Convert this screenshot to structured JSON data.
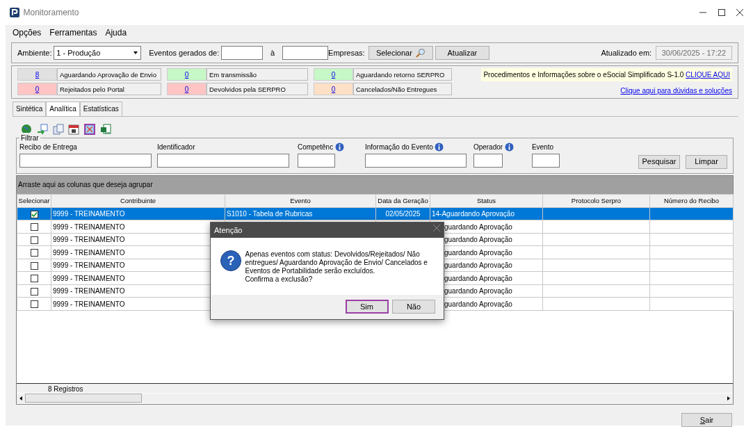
{
  "window": {
    "title": "Monitoramento"
  },
  "menu": [
    "Opções",
    "Ferramentas",
    "Ajuda"
  ],
  "top_bar": {
    "ambiente_label": "Ambiente:",
    "ambiente_value": "1 - Produção",
    "eventos_label": "Eventos gerados de:",
    "to_label": "à",
    "empresas_label": "Empresas:",
    "select_button": "Selecionar",
    "refresh_button": "Atualizar",
    "updated_label": "Atualizado em:",
    "updated_value": "30/06/2025 - 17:22"
  },
  "counters": [
    {
      "count": "8",
      "label": "Aguardando Aprovação de Envio",
      "color": "#e1e1e1"
    },
    {
      "count": "0",
      "label": "Em transmissão",
      "color": "#c6f7c6"
    },
    {
      "count": "0",
      "label": "Aguardando retorno SERPRO",
      "color": "#c6f7c6"
    },
    {
      "count": "0",
      "label": "Rejeitados pelo Portal",
      "color": "#ffc4c4"
    },
    {
      "count": "0",
      "label": "Devolvidos pela SERPRO",
      "color": "#ffc4c4"
    },
    {
      "count": "0",
      "label": "Cancelados/Não Entregues",
      "color": "#fde0c6"
    }
  ],
  "info": {
    "text": "Procedimentos e Informações sobre o eSocial Simplificado S-1.0",
    "link": "CLIQUE AQUI",
    "help_link": "Clique aqui para dúvidas e soluções"
  },
  "tabs": [
    {
      "label": "Sintética",
      "selected": false
    },
    {
      "label": "Analítica",
      "selected": true
    },
    {
      "label": "Estatísticas",
      "selected": false
    }
  ],
  "toolbar": [
    {
      "kind": "globe",
      "highlighted": false
    },
    {
      "kind": "transfer",
      "highlighted": false
    },
    {
      "kind": "copy",
      "highlighted": false
    },
    {
      "kind": "calendar",
      "highlighted": false
    },
    {
      "kind": "delete",
      "highlighted": true
    },
    {
      "kind": "excel",
      "highlighted": false
    }
  ],
  "filter": {
    "title": "Filtrar",
    "fields": [
      {
        "label": "Recibo de Entrega",
        "info": false
      },
      {
        "label": "Identificador",
        "info": false
      },
      {
        "label": "Competênc",
        "info": true
      },
      {
        "label": "Informação do Evento",
        "info": true
      },
      {
        "label": "Operador",
        "info": true
      },
      {
        "label": "Evento",
        "info": false
      }
    ],
    "search_button": "Pesquisar",
    "clear_button": "Limpar"
  },
  "grid": {
    "group_hint": "Arraste aqui as colunas que deseja agrupar",
    "columns": [
      "Selecionar",
      "Contribuinte",
      "Evento",
      "Data da Geração",
      "Status",
      "Protocolo Serpro",
      "Número do Recibo"
    ],
    "rows": [
      {
        "selected": true,
        "checked": true,
        "contribuinte": "9999 - TREINAMENTO",
        "evento": "S1010 - Tabela de Rubricas",
        "data": "02/05/2025",
        "status": "14-Aguardando Aprovação"
      },
      {
        "selected": false,
        "checked": false,
        "contribuinte": "9999 - TREINAMENTO",
        "status": "guardando Aprovação"
      },
      {
        "selected": false,
        "checked": false,
        "contribuinte": "9999 - TREINAMENTO",
        "status": "guardando Aprovação"
      },
      {
        "selected": false,
        "checked": false,
        "contribuinte": "9999 - TREINAMENTO",
        "status": "guardando Aprovação"
      },
      {
        "selected": false,
        "checked": false,
        "contribuinte": "9999 - TREINAMENTO",
        "status": "guardando Aprovação"
      },
      {
        "selected": false,
        "checked": false,
        "contribuinte": "9999 - TREINAMENTO",
        "status": "guardando Aprovação"
      },
      {
        "selected": false,
        "checked": false,
        "contribuinte": "9999 - TREINAMENTO",
        "status": "guardando Aprovação"
      },
      {
        "selected": false,
        "checked": false,
        "contribuinte": "9999 - TREINAMENTO",
        "status": "guardando Aprovação"
      }
    ],
    "footer": "8 Registros"
  },
  "exit_button": "Sair",
  "dialog": {
    "title": "Atenção",
    "icon_glyph": "?",
    "message": [
      "Apenas eventos com status: Devolvidos/Rejeitados/ Não",
      "entregues/ Aguardando Aprovação de Envio/ Cancelados e",
      "Eventos de Portabilidade serão excluídos.",
      "Confirma a exclusão?"
    ],
    "buttons": [
      {
        "label": "Sim",
        "highlighted": true
      },
      {
        "label": "Não",
        "highlighted": false
      }
    ]
  }
}
